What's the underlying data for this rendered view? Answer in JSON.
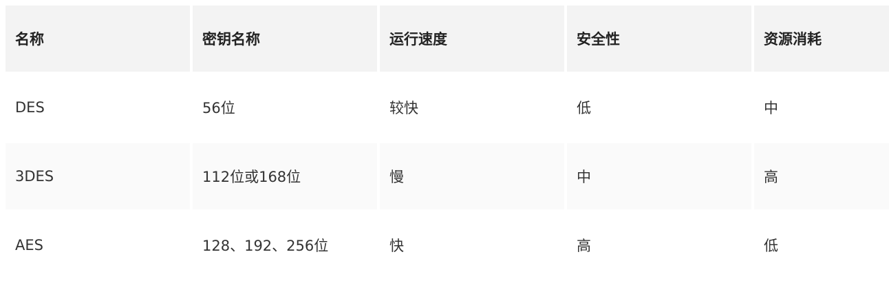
{
  "table": {
    "headers": [
      "名称",
      "密钥名称",
      "运行速度",
      "安全性",
      "资源消耗"
    ],
    "rows": [
      [
        "DES",
        "56位",
        "较快",
        "低",
        "中"
      ],
      [
        "3DES",
        "112位或168位",
        "慢",
        "中",
        "高"
      ],
      [
        "AES",
        "128、192、256位",
        "快",
        "高",
        "低"
      ]
    ]
  }
}
